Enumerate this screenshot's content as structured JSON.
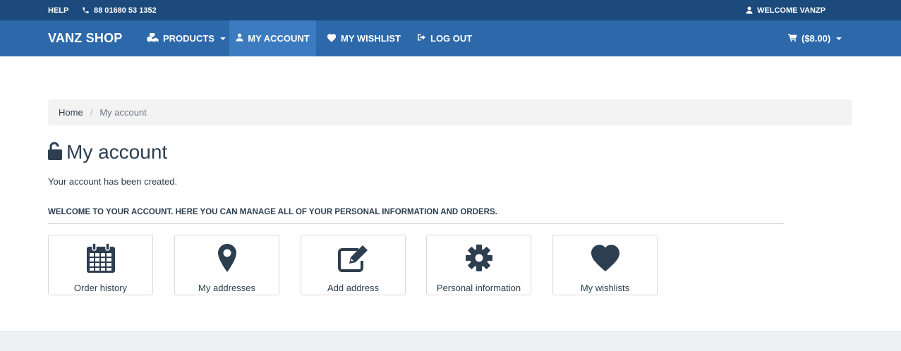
{
  "topbar": {
    "help": "HELP",
    "phone": "88 01680 53 1352",
    "welcome": "WELCOME VANZP"
  },
  "navbar": {
    "brand": "VANZ SHOP",
    "items": [
      {
        "label": "PRODUCTS",
        "icon": "cubes-icon"
      },
      {
        "label": "MY ACCOUNT",
        "icon": "user-icon"
      },
      {
        "label": "MY WISHLIST",
        "icon": "heart-icon"
      },
      {
        "label": "LOG OUT",
        "icon": "sign-out-icon"
      }
    ],
    "cart": "($8.00)"
  },
  "breadcrumb": {
    "home": "Home",
    "current": "My account"
  },
  "page": {
    "title": "My account",
    "message": "Your account has been created.",
    "welcome": "WELCOME TO YOUR ACCOUNT. HERE YOU CAN MANAGE ALL OF YOUR PERSONAL INFORMATION AND ORDERS."
  },
  "tiles": [
    {
      "label": "Order history",
      "icon": "calendar-icon"
    },
    {
      "label": "My addresses",
      "icon": "map-marker-icon"
    },
    {
      "label": "Add address",
      "icon": "edit-icon"
    },
    {
      "label": "Personal information",
      "icon": "gear-icon"
    },
    {
      "label": "My wishlists",
      "icon": "heart-icon"
    }
  ],
  "colors": {
    "topbar": "#1d4a7c",
    "navbar": "#2d68aa",
    "nav_active": "#3c7bbf",
    "text": "#2c3e50"
  }
}
